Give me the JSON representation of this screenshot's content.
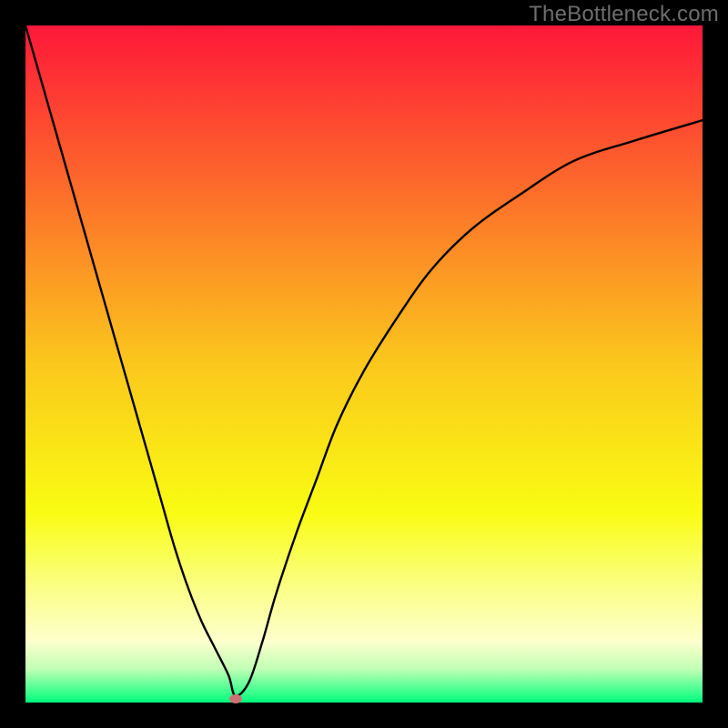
{
  "watermark": "TheBottleneck.com",
  "chart_data": {
    "type": "line",
    "title": "",
    "xlabel": "",
    "ylabel": "",
    "xlim": [
      0,
      100
    ],
    "ylim": [
      0,
      100
    ],
    "grid": false,
    "background": {
      "type": "vertical-gradient",
      "stops": [
        {
          "offset": 0.0,
          "color": "#fe1739"
        },
        {
          "offset": 0.25,
          "color": "#fd6f2a"
        },
        {
          "offset": 0.5,
          "color": "#fbc81c"
        },
        {
          "offset": 0.72,
          "color": "#f9fc12"
        },
        {
          "offset": 0.83,
          "color": "#fbff86"
        },
        {
          "offset": 0.91,
          "color": "#fdffcc"
        },
        {
          "offset": 0.95,
          "color": "#c2ffb5"
        },
        {
          "offset": 1.0,
          "color": "#00ff7b"
        }
      ]
    },
    "series": [
      {
        "name": "bottleneck-curve",
        "color": "#000000",
        "x": [
          0,
          2,
          4,
          6,
          8,
          10,
          12,
          14,
          16,
          18,
          20,
          22,
          24,
          26,
          28,
          30,
          31,
          33,
          35,
          37,
          40,
          43,
          46,
          50,
          55,
          60,
          66,
          73,
          81,
          90,
          100
        ],
        "values": [
          100,
          93,
          86,
          79,
          72,
          65,
          58,
          51,
          44,
          37,
          30,
          23,
          17,
          12,
          8,
          4,
          1,
          3,
          9,
          16,
          25,
          33,
          41,
          49,
          57,
          64,
          70,
          75,
          80,
          83,
          86
        ]
      }
    ],
    "marker": {
      "name": "optimal-point",
      "x": 31,
      "y": 0.5,
      "color": "#cb7374"
    }
  }
}
